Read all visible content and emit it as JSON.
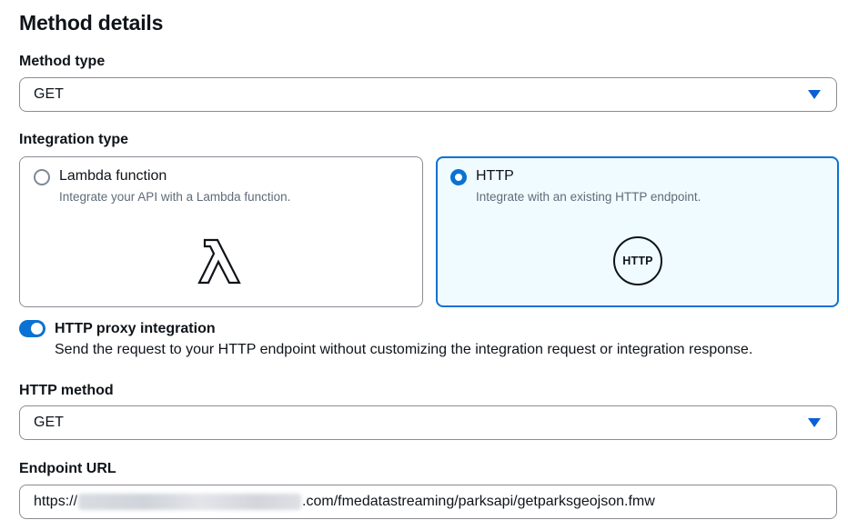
{
  "page_title": "Method details",
  "method_type": {
    "label": "Method type",
    "selected": "GET"
  },
  "integration_type": {
    "label": "Integration type",
    "options": [
      {
        "title": "Lambda function",
        "description": "Integrate your API with a Lambda function.",
        "selected": false,
        "icon": "lambda-icon"
      },
      {
        "title": "HTTP",
        "description": "Integrate with an existing HTTP endpoint.",
        "selected": true,
        "icon": "http-icon",
        "icon_text": "HTTP"
      }
    ]
  },
  "http_proxy": {
    "label": "HTTP proxy integration",
    "description": "Send the request to your HTTP endpoint without customizing the integration request or integration response.",
    "enabled": true
  },
  "http_method": {
    "label": "HTTP method",
    "selected": "GET"
  },
  "endpoint_url": {
    "label": "Endpoint URL",
    "value_prefix": "https://",
    "value_suffix": ".com/fmedatastreaming/parksapi/getparksgeojson.fmw"
  },
  "colors": {
    "accent": "#0972d3",
    "selected_card_bg": "#f0fbff",
    "text": "#0f141a",
    "secondary_text": "#5f6b7a"
  }
}
